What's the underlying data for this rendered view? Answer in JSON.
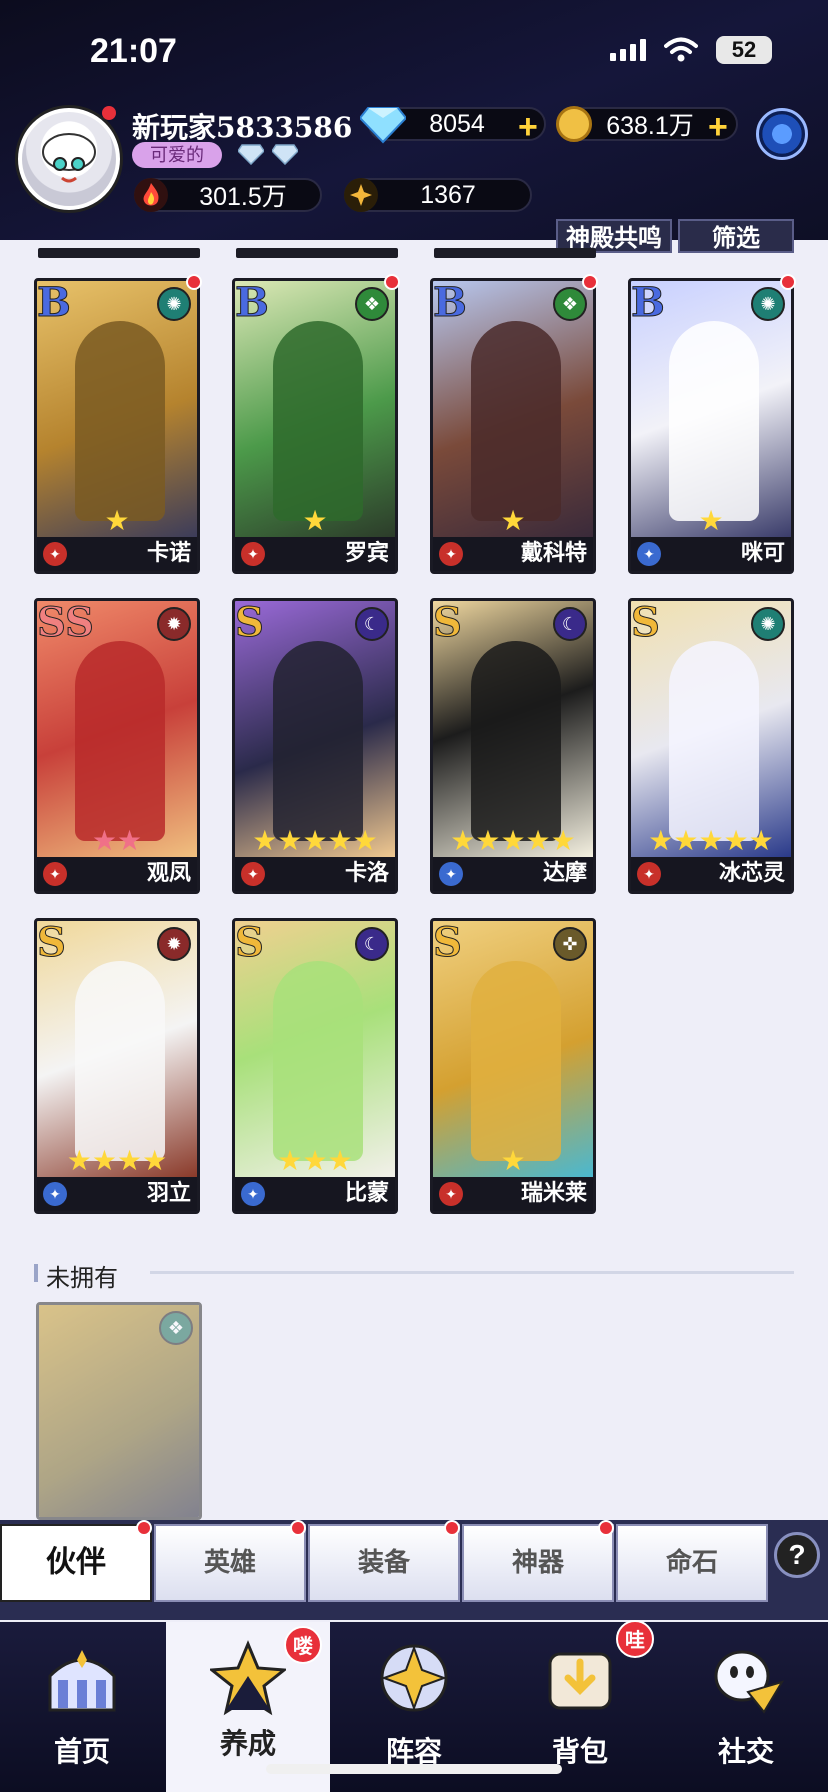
{
  "status_bar": {
    "time": "21:07",
    "battery": "52"
  },
  "player": {
    "name": "新玩家5833586",
    "title": "可爱的",
    "power": "301.5万",
    "medals": "1367"
  },
  "resources": {
    "gems": "8054",
    "gold": "638.1万"
  },
  "filters": {
    "resonance": "神殿共鸣",
    "filter": "筛选"
  },
  "heroes": [
    {
      "grade": "B",
      "name": "卡诺",
      "stars": 1,
      "element": "wind"
    },
    {
      "grade": "B",
      "name": "罗宾",
      "stars": 1,
      "element": "nature"
    },
    {
      "grade": "B",
      "name": "戴科特",
      "stars": 1,
      "element": "nature"
    },
    {
      "grade": "B",
      "name": "咪可",
      "stars": 1,
      "element": "wind"
    },
    {
      "grade": "SS",
      "name": "观凤",
      "stars": 2,
      "element": "fire"
    },
    {
      "grade": "S",
      "name": "卡洛",
      "stars": 5,
      "element": "moon"
    },
    {
      "grade": "S",
      "name": "达摩",
      "stars": 5,
      "element": "moon"
    },
    {
      "grade": "S",
      "name": "冰芯灵",
      "stars": 5,
      "element": "wind"
    },
    {
      "grade": "S",
      "name": "羽立",
      "stars": 4,
      "element": "fire"
    },
    {
      "grade": "S",
      "name": "比蒙",
      "stars": 3,
      "element": "moon"
    },
    {
      "grade": "S",
      "name": "瑞米莱",
      "stars": 1,
      "element": "light"
    }
  ],
  "unowned_section": {
    "label": "未拥有"
  },
  "subtabs": {
    "partner": "伙伴",
    "heroes": "英雄",
    "equipment": "装备",
    "artifacts": "神器",
    "fate_stones": "命石"
  },
  "nav": {
    "home": "首页",
    "develop": "养成",
    "lineup": "阵容",
    "bag": "背包",
    "social": "社交",
    "badge_develop": "喽",
    "badge_bag": "哇"
  }
}
